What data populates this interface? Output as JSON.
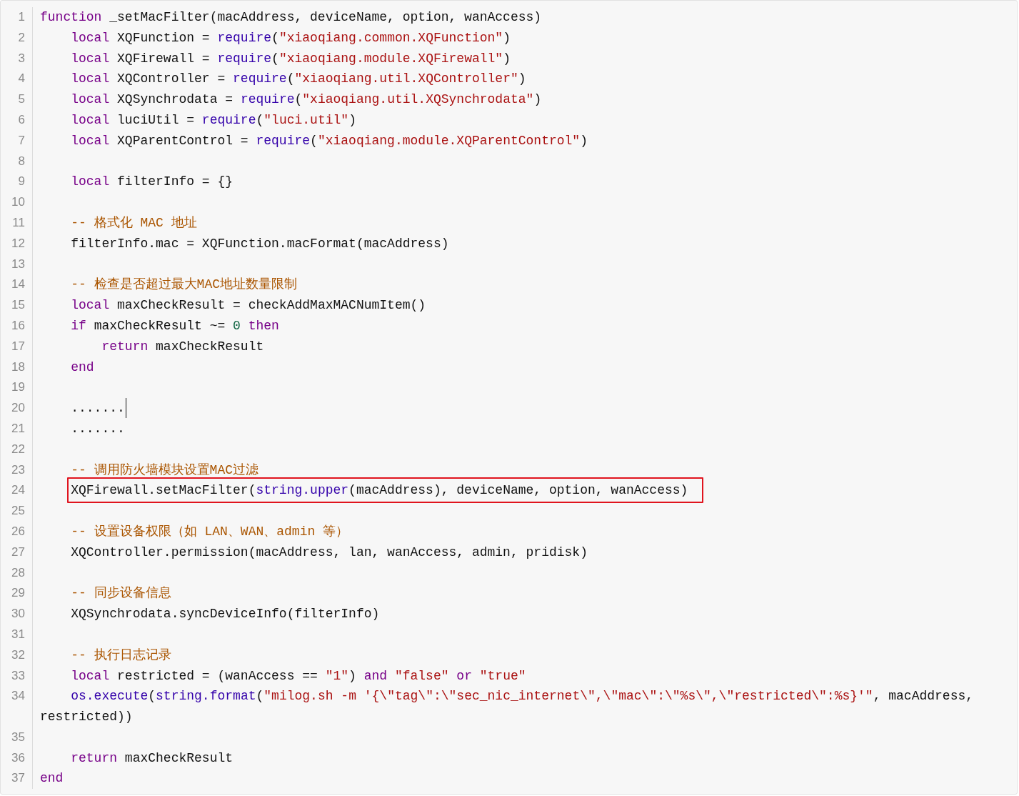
{
  "code_view": {
    "lines": [
      {
        "number": "1",
        "tokens": [
          {
            "kind": "keyword",
            "text": "function"
          },
          {
            "kind": "plain",
            "text": " _setMacFilter(macAddress, deviceName, option, wanAccess)"
          }
        ]
      },
      {
        "number": "2",
        "tokens": [
          {
            "kind": "keyword",
            "text": "    local"
          },
          {
            "kind": "plain",
            "text": " XQFunction = "
          },
          {
            "kind": "builtin",
            "text": "require"
          },
          {
            "kind": "plain",
            "text": "("
          },
          {
            "kind": "string",
            "text": "\"xiaoqiang.common.XQFunction\""
          },
          {
            "kind": "plain",
            "text": ")"
          }
        ]
      },
      {
        "number": "3",
        "tokens": [
          {
            "kind": "keyword",
            "text": "    local"
          },
          {
            "kind": "plain",
            "text": " XQFirewall = "
          },
          {
            "kind": "builtin",
            "text": "require"
          },
          {
            "kind": "plain",
            "text": "("
          },
          {
            "kind": "string",
            "text": "\"xiaoqiang.module.XQFirewall\""
          },
          {
            "kind": "plain",
            "text": ")"
          }
        ]
      },
      {
        "number": "4",
        "tokens": [
          {
            "kind": "keyword",
            "text": "    local"
          },
          {
            "kind": "plain",
            "text": " XQController = "
          },
          {
            "kind": "builtin",
            "text": "require"
          },
          {
            "kind": "plain",
            "text": "("
          },
          {
            "kind": "string",
            "text": "\"xiaoqiang.util.XQController\""
          },
          {
            "kind": "plain",
            "text": ")"
          }
        ]
      },
      {
        "number": "5",
        "tokens": [
          {
            "kind": "keyword",
            "text": "    local"
          },
          {
            "kind": "plain",
            "text": " XQSynchrodata = "
          },
          {
            "kind": "builtin",
            "text": "require"
          },
          {
            "kind": "plain",
            "text": "("
          },
          {
            "kind": "string",
            "text": "\"xiaoqiang.util.XQSynchrodata\""
          },
          {
            "kind": "plain",
            "text": ")"
          }
        ]
      },
      {
        "number": "6",
        "tokens": [
          {
            "kind": "keyword",
            "text": "    local"
          },
          {
            "kind": "plain",
            "text": " luciUtil = "
          },
          {
            "kind": "builtin",
            "text": "require"
          },
          {
            "kind": "plain",
            "text": "("
          },
          {
            "kind": "string",
            "text": "\"luci.util\""
          },
          {
            "kind": "plain",
            "text": ")"
          }
        ]
      },
      {
        "number": "7",
        "tokens": [
          {
            "kind": "keyword",
            "text": "    local"
          },
          {
            "kind": "plain",
            "text": " XQParentControl = "
          },
          {
            "kind": "builtin",
            "text": "require"
          },
          {
            "kind": "plain",
            "text": "("
          },
          {
            "kind": "string",
            "text": "\"xiaoqiang.module.XQParentControl\""
          },
          {
            "kind": "plain",
            "text": ")"
          }
        ]
      },
      {
        "number": "8"
      },
      {
        "number": "9",
        "tokens": [
          {
            "kind": "keyword",
            "text": "    local"
          },
          {
            "kind": "plain",
            "text": " filterInfo = {}"
          }
        ]
      },
      {
        "number": "10"
      },
      {
        "number": "11",
        "tokens": [
          {
            "kind": "comment",
            "text": "    -- 格式化 MAC 地址"
          }
        ]
      },
      {
        "number": "12",
        "tokens": [
          {
            "kind": "plain",
            "text": "    filterInfo.mac = XQFunction.macFormat(macAddress)"
          }
        ]
      },
      {
        "number": "13"
      },
      {
        "number": "14",
        "tokens": [
          {
            "kind": "comment",
            "text": "    -- 检查是否超过最大MAC地址数量限制"
          }
        ]
      },
      {
        "number": "15",
        "tokens": [
          {
            "kind": "keyword",
            "text": "    local"
          },
          {
            "kind": "plain",
            "text": " maxCheckResult = checkAddMaxMACNumItem()"
          }
        ]
      },
      {
        "number": "16",
        "tokens": [
          {
            "kind": "keyword",
            "text": "    if"
          },
          {
            "kind": "plain",
            "text": " maxCheckResult ~= "
          },
          {
            "kind": "number",
            "text": "0"
          },
          {
            "kind": "keyword",
            "text": " then"
          }
        ]
      },
      {
        "number": "17",
        "tokens": [
          {
            "kind": "keyword",
            "text": "        return"
          },
          {
            "kind": "plain",
            "text": " maxCheckResult"
          }
        ]
      },
      {
        "number": "18",
        "tokens": [
          {
            "kind": "keyword",
            "text": "    end"
          }
        ]
      },
      {
        "number": "19"
      },
      {
        "number": "20",
        "cursor": true,
        "tokens": [
          {
            "kind": "plain",
            "text": "    ......."
          }
        ]
      },
      {
        "number": "21",
        "tokens": [
          {
            "kind": "plain",
            "text": "    ......."
          }
        ]
      },
      {
        "number": "22"
      },
      {
        "number": "23",
        "tokens": [
          {
            "kind": "comment",
            "text": "    -- 调用防火墙模块设置MAC过滤"
          }
        ]
      },
      {
        "number": "24",
        "highlighted": true,
        "tokens": [
          {
            "kind": "plain",
            "text": "    XQFirewall.setMacFilter("
          },
          {
            "kind": "builtin",
            "text": "string.upper"
          },
          {
            "kind": "plain",
            "text": "(macAddress), deviceName, option, wanAccess)"
          }
        ]
      },
      {
        "number": "25"
      },
      {
        "number": "26",
        "tokens": [
          {
            "kind": "comment",
            "text": "    -- 设置设备权限（如 LAN、WAN、admin 等）"
          }
        ]
      },
      {
        "number": "27",
        "tokens": [
          {
            "kind": "plain",
            "text": "    XQController.permission(macAddress, lan, wanAccess, admin, pridisk)"
          }
        ]
      },
      {
        "number": "28"
      },
      {
        "number": "29",
        "tokens": [
          {
            "kind": "comment",
            "text": "    -- 同步设备信息"
          }
        ]
      },
      {
        "number": "30",
        "tokens": [
          {
            "kind": "plain",
            "text": "    XQSynchrodata.syncDeviceInfo(filterInfo)"
          }
        ]
      },
      {
        "number": "31"
      },
      {
        "number": "32",
        "tokens": [
          {
            "kind": "comment",
            "text": "    -- 执行日志记录"
          }
        ]
      },
      {
        "number": "33",
        "tokens": [
          {
            "kind": "keyword",
            "text": "    local"
          },
          {
            "kind": "plain",
            "text": " restricted = (wanAccess == "
          },
          {
            "kind": "string",
            "text": "\"1\""
          },
          {
            "kind": "plain",
            "text": ") "
          },
          {
            "kind": "keyword",
            "text": "and"
          },
          {
            "kind": "string",
            "text": " \"false\""
          },
          {
            "kind": "keyword",
            "text": " or"
          },
          {
            "kind": "string",
            "text": " \"true\""
          }
        ]
      },
      {
        "number": "34",
        "tokens": [
          {
            "kind": "builtin",
            "text": "    os.execute"
          },
          {
            "kind": "plain",
            "text": "("
          },
          {
            "kind": "builtin",
            "text": "string.format"
          },
          {
            "kind": "plain",
            "text": "("
          },
          {
            "kind": "string",
            "text": "\"milog.sh -m '{\\\"tag\\\":\\\"sec_nic_internet\\\",\\\"mac\\\":\\\"%s\\\",\\\"restricted\\\":%s}'\""
          },
          {
            "kind": "plain",
            "text": ", macAddress, restricted))"
          }
        ]
      },
      {
        "number": "35"
      },
      {
        "number": "36",
        "tokens": [
          {
            "kind": "keyword",
            "text": "    return"
          },
          {
            "kind": "plain",
            "text": " maxCheckResult"
          }
        ]
      },
      {
        "number": "37",
        "tokens": [
          {
            "kind": "keyword",
            "text": "end"
          }
        ]
      }
    ]
  }
}
